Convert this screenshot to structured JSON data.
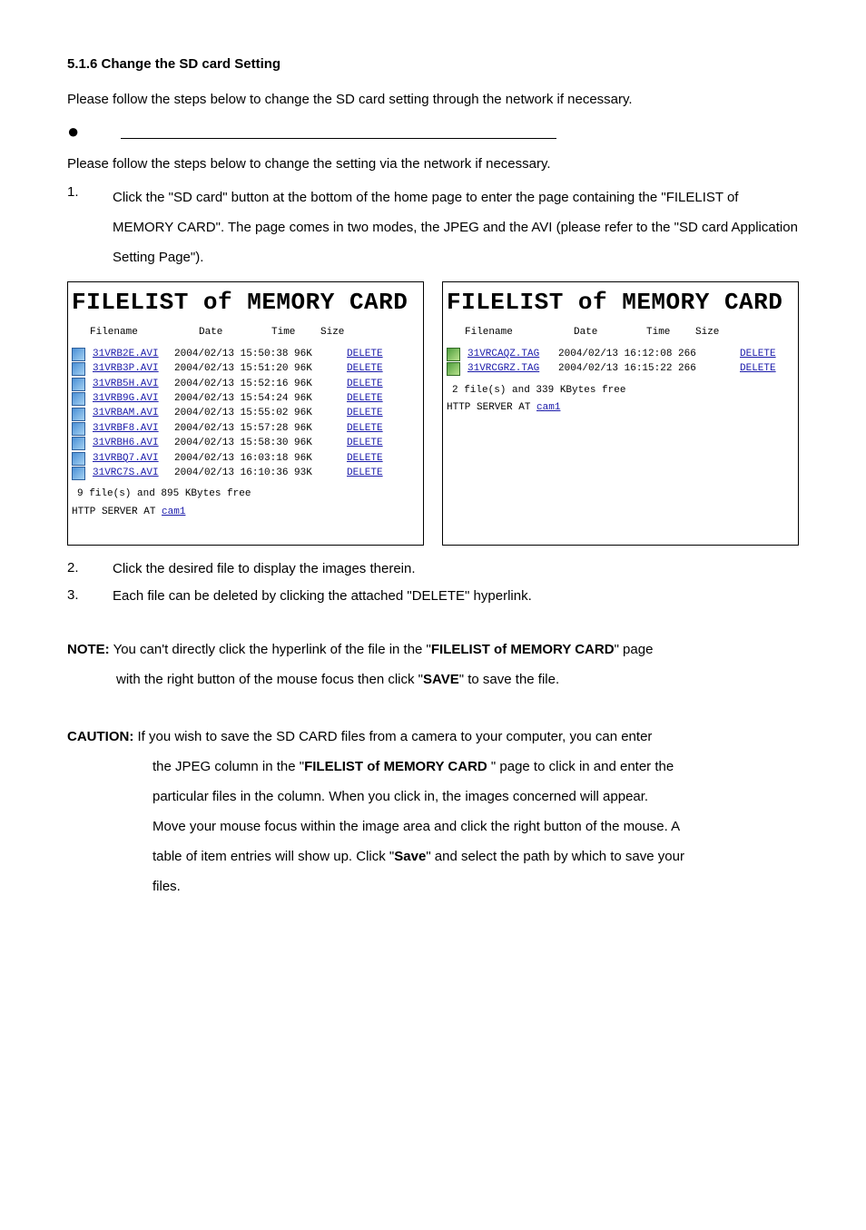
{
  "heading": "5.1.6  Change the SD card Setting",
  "intro1": "Please follow the steps below to change the SD card setting through the network if necessary.",
  "intro2": "Please follow the steps below to change the setting via the network if necessary.",
  "step1_num": "1.",
  "step1_txt": "Click the \"SD card\" button at the bottom of the home page to enter the page containing the \"FILELIST of MEMORY CARD\". The page comes in two modes, the JPEG and the AVI (please refer to the \"SD card Application Setting Page\").",
  "step2_num": "2.",
  "step2_txt": "Click the desired file to display the images therein.",
  "step3_num": "3.",
  "step3_txt": "Each file can be deleted by clicking the attached \"DELETE\" hyperlink.",
  "panel_title": "FILELIST of MEMORY CARD",
  "hdr_fn": "Filename",
  "hdr_dt": "Date",
  "hdr_tm": "Time",
  "hdr_sz": "Size",
  "left_files": [
    {
      "name": "31VRB2E.AVI",
      "dt": "2004/02/13 15:50:38 96K"
    },
    {
      "name": "31VRB3P.AVI",
      "dt": "2004/02/13 15:51:20 96K"
    },
    {
      "name": "31VRB5H.AVI",
      "dt": "2004/02/13 15:52:16 96K"
    },
    {
      "name": "31VRB9G.AVI",
      "dt": "2004/02/13 15:54:24 96K"
    },
    {
      "name": "31VRBAM.AVI",
      "dt": "2004/02/13 15:55:02 96K"
    },
    {
      "name": "31VRBF8.AVI",
      "dt": "2004/02/13 15:57:28 96K"
    },
    {
      "name": "31VRBH6.AVI",
      "dt": "2004/02/13 15:58:30 96K"
    },
    {
      "name": "31VRBQ7.AVI",
      "dt": "2004/02/13 16:03:18 96K"
    },
    {
      "name": "31VRC7S.AVI",
      "dt": "2004/02/13 16:10:36 93K"
    }
  ],
  "left_summary": "9 file(s) and 895 KBytes free",
  "right_files": [
    {
      "name": "31VRCAQZ.TAG",
      "dt": "2004/02/13 16:12:08 266"
    },
    {
      "name": "31VRCGRZ.TAG",
      "dt": "2004/02/13 16:15:22 266"
    }
  ],
  "right_summary": "2 file(s) and 339 KBytes free",
  "server_prefix": "HTTP SERVER AT ",
  "server_link": "cam1",
  "delete_label": "DELETE",
  "note_label": "NOTE:",
  "note_text1": " You can't directly click the hyperlink of the file in the \"",
  "note_bold1": "FILELIST of MEMORY CARD",
  "note_text2": "\" page",
  "note_line2a": "with the right button of the mouse focus then click \"",
  "note_bold2": "SAVE",
  "note_line2b": "\" to save the file.",
  "caution_label": "CAUTION:",
  "caution_text1": " If you wish to save the SD CARD files from a camera to your computer, you can enter",
  "caution_l2a": "the JPEG column in the \"",
  "caution_l2bold": "FILELIST of MEMORY CARD ",
  "caution_l2b": "\" page to click in and enter the",
  "caution_l3": "particular files in the column. When you click in, the images concerned will appear.",
  "caution_l4": "Move your mouse focus within the image area and click the right button of the mouse. A",
  "caution_l5a": "table of item entries will show up. Click \"",
  "caution_l5bold": "Save",
  "caution_l5b": "\" and select the path by which to save your",
  "caution_l6": "files."
}
